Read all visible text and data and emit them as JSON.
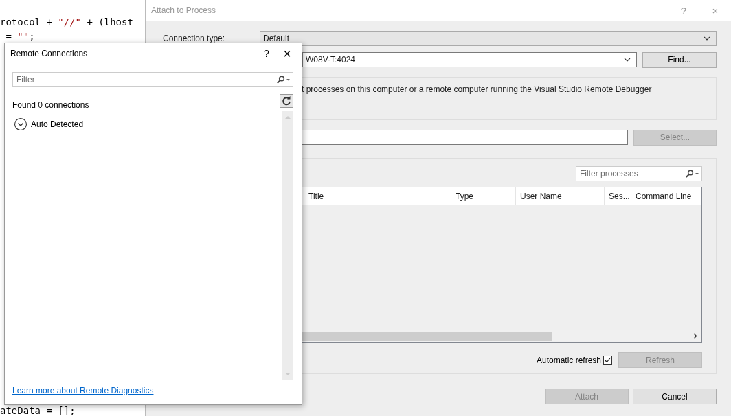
{
  "editor": {
    "top_lines": [
      [
        {
          "text": "rotocol + ",
          "kind": "plain"
        },
        {
          "text": "\"//\"",
          "kind": "string"
        },
        {
          "text": " + (lhost",
          "kind": "plain"
        }
      ],
      [
        {
          "text": " = ",
          "kind": "plain"
        },
        {
          "text": "\"\"",
          "kind": "string"
        },
        {
          "text": ";",
          "kind": "plain"
        }
      ]
    ],
    "bottom_lines": [
      [
        {
          "text": "ateData = [];",
          "kind": "plain"
        }
      ]
    ]
  },
  "attach_dialog": {
    "title": "Attach to Process",
    "help": "?",
    "close": "×",
    "connection_type": {
      "label": "Connection type:",
      "value": "Default"
    },
    "connection_target": {
      "value": "W08V-T:4024"
    },
    "find_button": {
      "label": "Find...",
      "disabled": false
    },
    "info": "t processes on this computer or a remote computer running the Visual Studio Remote Debugger",
    "select_button": {
      "label": "Select...",
      "disabled": true
    },
    "filter": {
      "placeholder": "Filter processes"
    },
    "table": {
      "columns": [
        "Title",
        "Type",
        "User Name",
        "Ses...",
        "Command Line"
      ]
    },
    "automatic_refresh": {
      "label": "Automatic refresh",
      "checked": true
    },
    "refresh_button": {
      "label": "Refresh",
      "disabled": true
    },
    "buttons": [
      {
        "label": "Attach",
        "disabled": true
      },
      {
        "label": "Cancel",
        "disabled": false
      }
    ]
  },
  "remote_connections": {
    "title": "Remote Connections",
    "help": "?",
    "close": "×",
    "filter": {
      "placeholder": "Filter"
    },
    "status": "Found 0 connections",
    "groups": [
      {
        "label": "Auto Detected",
        "expanded": true
      }
    ],
    "link": "Learn more about Remote Diagnostics"
  }
}
